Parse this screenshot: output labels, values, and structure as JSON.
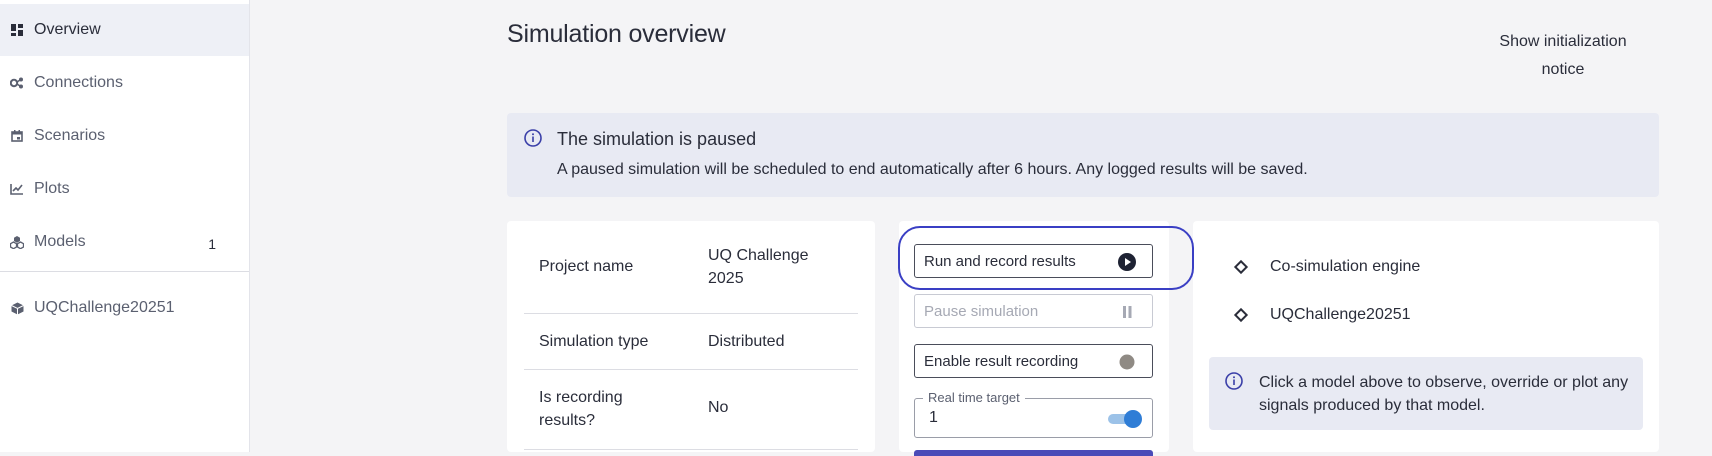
{
  "sidebar": {
    "items": [
      {
        "label": "Overview",
        "icon": "dashboard-icon"
      },
      {
        "label": "Connections",
        "icon": "connections-icon"
      },
      {
        "label": "Scenarios",
        "icon": "calendar-icon"
      },
      {
        "label": "Plots",
        "icon": "chart-icon"
      },
      {
        "label": "Models",
        "icon": "models-icon",
        "badge": "1"
      }
    ],
    "project": {
      "label": "UQChallenge20251",
      "icon": "package-icon"
    }
  },
  "header": {
    "title": "Simulation overview",
    "init_notice": "Show initialization notice"
  },
  "alert": {
    "title": "The simulation is paused",
    "message": "A paused simulation will be scheduled to end automatically after 6 hours. Any logged results will be saved."
  },
  "project": {
    "rows": [
      {
        "label": "Project name",
        "value": "UQ Challenge 2025"
      },
      {
        "label": "Simulation type",
        "value": "Distributed"
      },
      {
        "label": "Is recording results?",
        "value": "No"
      }
    ]
  },
  "controls": {
    "run_label": "Run and record results",
    "pause_label": "Pause simulation",
    "record_label": "Enable result recording",
    "realtime_legend": "Real time target",
    "realtime_value": "1",
    "realtime_enabled": true
  },
  "models": {
    "items": [
      "Co-simulation engine",
      "UQChallenge20251"
    ],
    "info": "Click a model above to observe, override or plot any signals produced by that model."
  },
  "colors": {
    "accent": "#2f7dd6",
    "highlight": "#3a3fc4",
    "alert_bg": "#e8eaf3"
  }
}
